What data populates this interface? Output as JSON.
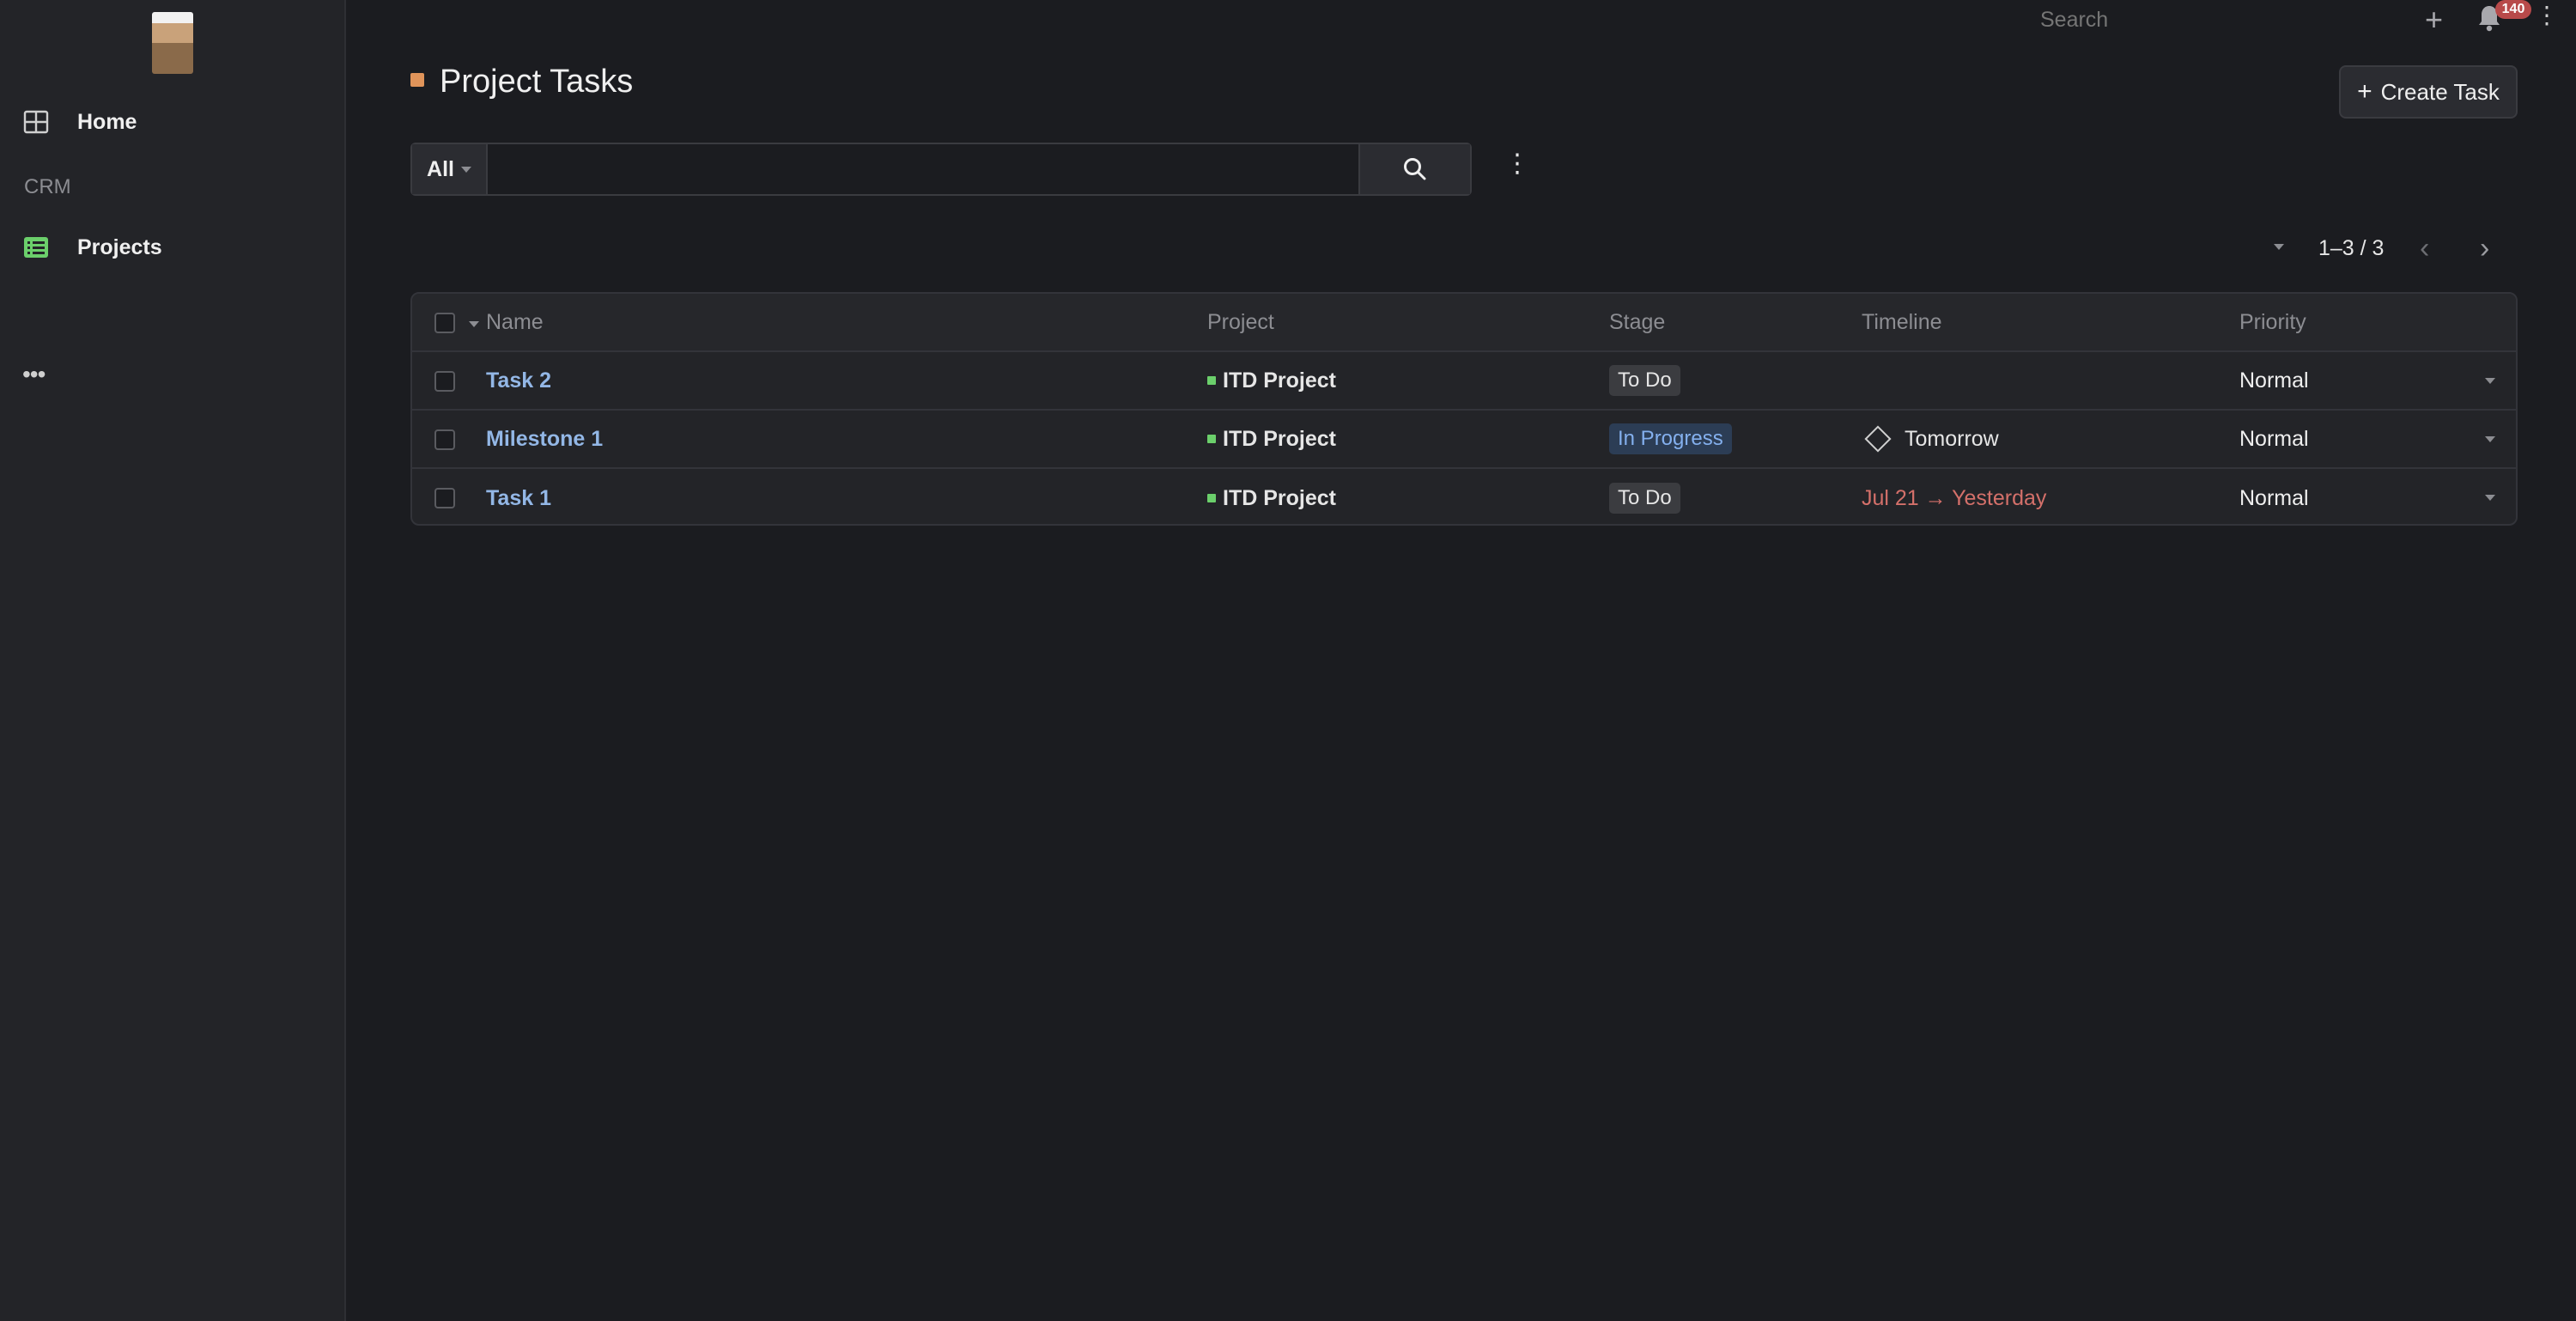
{
  "sidebar": {
    "items": [
      {
        "label": "Home",
        "icon": "grid-icon"
      },
      {
        "label": "Projects",
        "icon": "table-icon",
        "icon_color": "#6bcf6b"
      }
    ],
    "section_label": "CRM",
    "more": "•••"
  },
  "topbar": {
    "search_placeholder": "Search",
    "add": "+",
    "notifications_count": "140",
    "menu": "⋮"
  },
  "header": {
    "title": "Project Tasks",
    "title_color": "#e0945a",
    "create_label": "Create Task",
    "create_plus": "+"
  },
  "filter": {
    "select_value": "All",
    "input_value": "",
    "menu": "⋮"
  },
  "pagination": {
    "range": "1–3 / 3",
    "prev": "‹",
    "next": "›"
  },
  "table": {
    "columns": [
      "Name",
      "Project",
      "Stage",
      "Timeline",
      "Priority"
    ],
    "rows": [
      {
        "name": "Task 2",
        "project": "ITD Project",
        "stage": "To Do",
        "timeline": "",
        "priority": "Normal"
      },
      {
        "name": "Milestone 1",
        "project": "ITD Project",
        "stage": "In Progress",
        "timeline": "Tomorrow",
        "priority": "Normal"
      },
      {
        "name": "Task 1",
        "project": "ITD Project",
        "stage": "To Do",
        "timeline": "Jul 21 → Yesterday",
        "priority": "Normal"
      }
    ]
  },
  "colors": {
    "background": "#1b1c20",
    "sidebar": "#232428",
    "link": "#93b7e6",
    "overdue": "#d4706a",
    "in_progress": "#84b0ee",
    "notification_badge": "#b84a4a"
  }
}
